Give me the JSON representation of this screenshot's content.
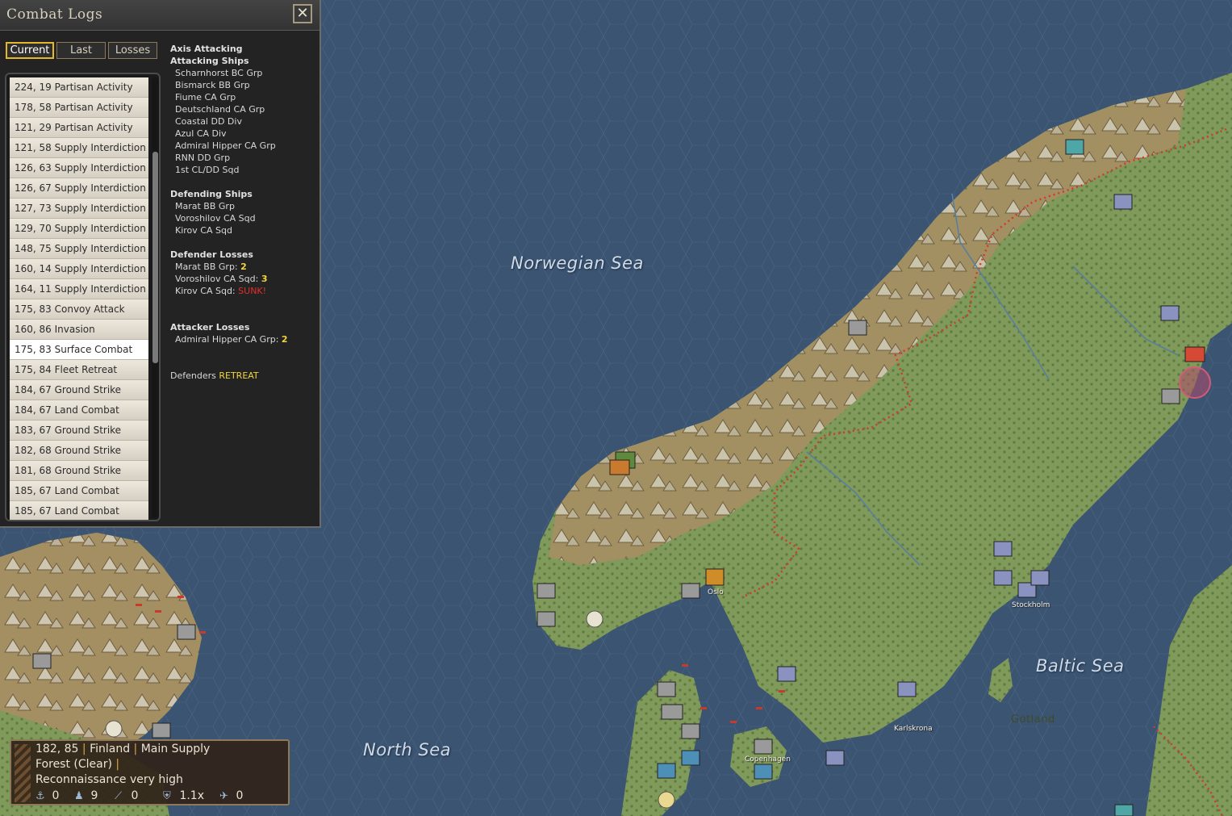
{
  "map": {
    "labels": {
      "norwegian_sea": "Norwegian Sea",
      "baltic_sea": "Baltic Sea",
      "north_sea": "North Sea",
      "gotland": "Gotland"
    },
    "towns": {
      "stockholm": "Stockholm",
      "oslo": "Oslo",
      "copenhagen": "Copenhagen",
      "karlskrona": "Karlskrona"
    },
    "colors": {
      "sea": "#3b5472",
      "land": "#7f9a5a",
      "mountain": "#a08c62",
      "front_line": "#d23a2a"
    }
  },
  "panel": {
    "title": "Combat Logs",
    "close_icon": "close-icon",
    "tabs": [
      "Current",
      "Last",
      "Losses"
    ],
    "active_tab": "Current",
    "events": [
      "224, 19 Partisan Activity",
      "178, 58 Partisan Activity",
      "121, 29 Partisan Activity",
      "121, 58 Supply Interdiction",
      "126, 63 Supply Interdiction",
      "126, 67 Supply Interdiction",
      "127, 73 Supply Interdiction",
      "129, 70 Supply Interdiction",
      "148, 75 Supply Interdiction",
      "160, 14 Supply Interdiction",
      "164, 11 Supply Interdiction",
      "175, 83 Convoy Attack",
      "160, 86 Invasion",
      "175, 83 Surface Combat",
      "175, 84 Fleet Retreat",
      "184, 67 Ground Strike",
      "184, 67 Land Combat",
      "183, 67 Ground Strike",
      "182, 68 Ground Strike",
      "181, 68 Ground Strike",
      "185, 67 Land Combat",
      "185, 67 Land Combat"
    ],
    "selected_index": 13,
    "detail": {
      "attacker_heading": "Axis Attacking",
      "attacking_ships_heading": "Attacking Ships",
      "attacking_ships": [
        "Scharnhorst BC Grp",
        "Bismarck BB Grp",
        "Fiume CA Grp",
        "Deutschland CA Grp",
        "Coastal DD Div",
        "Azul CA Div",
        "Admiral Hipper CA Grp",
        "RNN DD Grp",
        "1st CL/DD Sqd"
      ],
      "defending_ships_heading": "Defending Ships",
      "defending_ships": [
        "Marat BB Grp",
        "Voroshilov CA Sqd",
        "Kirov CA Sqd"
      ],
      "defender_losses_heading": "Defender Losses",
      "defender_losses": [
        {
          "name": "Marat BB Grp:",
          "value": "2"
        },
        {
          "name": "Voroshilov CA Sqd:",
          "value": "3"
        },
        {
          "name": "Kirov CA Sqd:",
          "value": "SUNK!"
        }
      ],
      "attacker_losses_heading": "Attacker Losses",
      "attacker_losses": [
        {
          "name": "Admiral Hipper CA Grp:",
          "value": "2"
        }
      ],
      "result_prefix": "Defenders",
      "result_value": "RETREAT"
    }
  },
  "hex_info": {
    "coords": "182, 85",
    "country": "Finland",
    "supply": "Main Supply",
    "terrain": "Forest (Clear)",
    "recon": "Reconnaissance very high",
    "stats": [
      {
        "icon": "anchor-icon",
        "value": "0"
      },
      {
        "icon": "soldier-icon",
        "value": "9"
      },
      {
        "icon": "artillery-icon",
        "value": "0"
      },
      {
        "icon": "shield-icon",
        "value": "1.1x"
      },
      {
        "icon": "aircraft-icon",
        "value": "0"
      }
    ]
  }
}
